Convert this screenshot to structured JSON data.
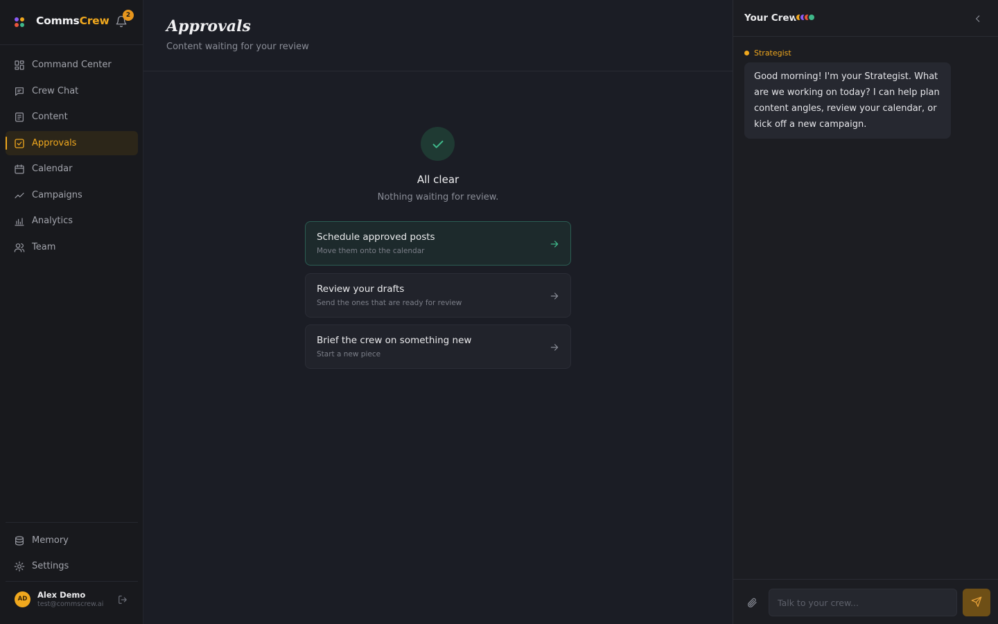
{
  "app": {
    "name_main": "Comms",
    "name_accent": "Crew",
    "notifications_count": "2",
    "brand_colors": [
      "#f0a81e",
      "#3fb88a",
      "#8b5cf6",
      "#e8553b"
    ]
  },
  "sidebar": {
    "items": [
      {
        "label": "Command Center",
        "icon": "dashboard-icon",
        "active": false
      },
      {
        "label": "Crew Chat",
        "icon": "chat-icon",
        "active": false
      },
      {
        "label": "Content",
        "icon": "document-icon",
        "active": false
      },
      {
        "label": "Approvals",
        "icon": "checkbox-icon",
        "active": true
      },
      {
        "label": "Calendar",
        "icon": "calendar-icon",
        "active": false
      },
      {
        "label": "Campaigns",
        "icon": "trend-icon",
        "active": false
      },
      {
        "label": "Analytics",
        "icon": "bar-chart-icon",
        "active": false
      },
      {
        "label": "Team",
        "icon": "users-icon",
        "active": false
      }
    ],
    "bottom_items": [
      {
        "label": "Memory",
        "icon": "database-icon"
      },
      {
        "label": "Settings",
        "icon": "gear-icon"
      }
    ],
    "user": {
      "initials": "AD",
      "name": "Alex Demo",
      "email": "test@commscrew.ai"
    }
  },
  "main": {
    "title": "Approvals",
    "subtitle": "Content waiting for your review",
    "empty_title": "All clear",
    "empty_subtitle": "Nothing waiting for review.",
    "actions": [
      {
        "title": "Schedule approved posts",
        "subtitle": "Move them onto the calendar",
        "primary": true
      },
      {
        "title": "Review your drafts",
        "subtitle": "Send the ones that are ready for review",
        "primary": false
      },
      {
        "title": "Brief the crew on something new",
        "subtitle": "Start a new piece",
        "primary": false
      }
    ]
  },
  "crew": {
    "title": "Your Crew",
    "agent_colors": [
      "#f0a81e",
      "#8b5cf6",
      "#e8553b",
      "#3fb88a"
    ],
    "agent_name": "Strategist",
    "message": "Good morning! I'm your Strategist. What are we working on today? I can help plan content angles, review your calendar, or kick off a new campaign.",
    "input_placeholder": "Talk to your crew..."
  },
  "colors": {
    "accent": "#f0a81e",
    "success": "#3fb88a"
  }
}
